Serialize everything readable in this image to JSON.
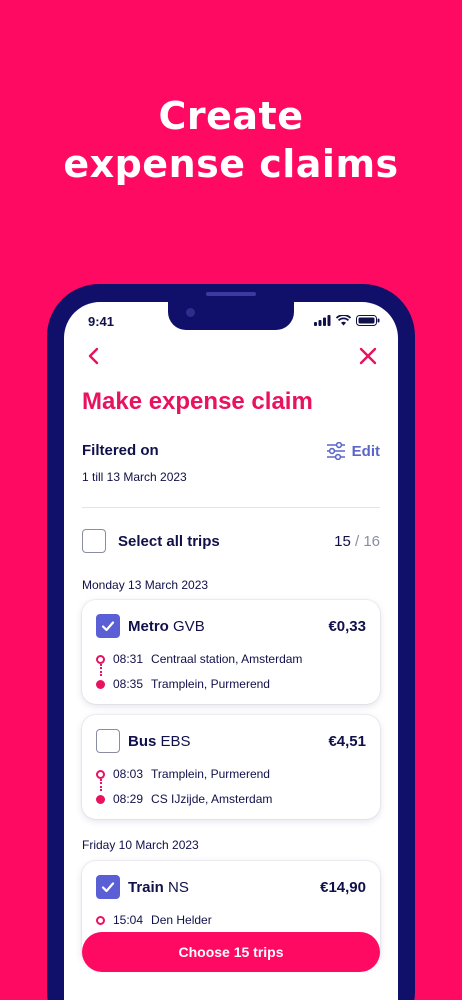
{
  "headline": {
    "line1": "Create",
    "line2": "expense claims"
  },
  "status_bar": {
    "time": "9:41"
  },
  "screen": {
    "title": "Make expense claim",
    "filter": {
      "label": "Filtered on",
      "date_range": "1 till 13 March 2023",
      "edit_label": "Edit"
    },
    "select_all": {
      "label": "Select all trips",
      "selected": "15",
      "separator": "/",
      "total": "16"
    },
    "groups": [
      {
        "date": "Monday 13 March 2023",
        "trips": [
          {
            "checked": true,
            "mode": "Metro",
            "operator": "GVB",
            "price": "€0,33",
            "from_time": "08:31",
            "from_place": "Centraal station, Amsterdam",
            "to_time": "08:35",
            "to_place": "Tramplein, Purmerend"
          },
          {
            "checked": false,
            "mode": "Bus",
            "operator": "EBS",
            "price": "€4,51",
            "from_time": "08:03",
            "from_place": "Tramplein, Purmerend",
            "to_time": "08:29",
            "to_place": "CS IJzijde, Amsterdam"
          }
        ]
      },
      {
        "date": "Friday 10 March 2023",
        "trips": [
          {
            "checked": true,
            "mode": "Train",
            "operator": "NS",
            "price": "€14,90",
            "from_time": "15:04",
            "from_place": "Den Helder"
          }
        ]
      }
    ],
    "cta_label": "Choose 15 trips"
  },
  "colors": {
    "brand": "#ff0a63",
    "navy": "#10104a",
    "accent": "#5b5fd6"
  }
}
